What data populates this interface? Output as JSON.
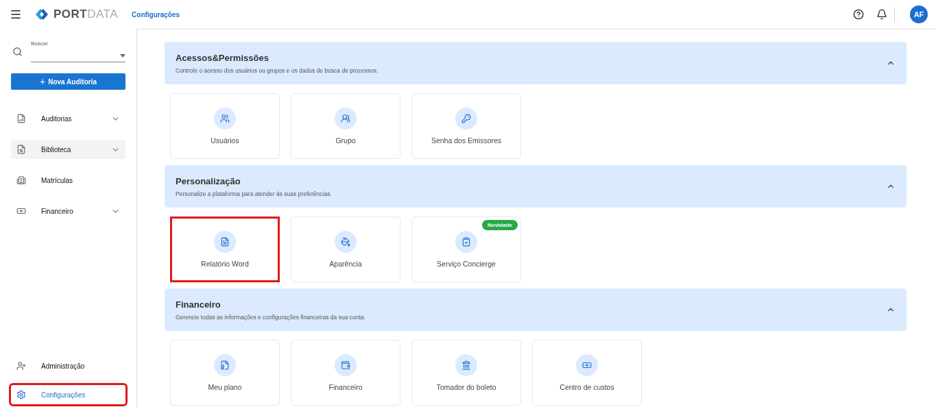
{
  "header": {
    "logo": {
      "bold": "PORT",
      "light": "DATA"
    },
    "breadcrumb": "Configurações",
    "avatar": "AF"
  },
  "sidebar": {
    "search": {
      "label": "Buscar"
    },
    "new_button": {
      "icon": "+",
      "label": "Nova Auditoria"
    },
    "items": [
      {
        "kind": "audits",
        "label": "Auditorias",
        "expandable": true,
        "hovered": false,
        "selected": false
      },
      {
        "kind": "library",
        "label": "Biblioteca",
        "expandable": true,
        "hovered": true,
        "selected": false
      },
      {
        "kind": "enrollments",
        "label": "Matrículas",
        "expandable": false,
        "hovered": false,
        "selected": false
      },
      {
        "kind": "finance",
        "label": "Financeiro",
        "expandable": true,
        "hovered": false,
        "selected": false
      }
    ],
    "bottom_items": [
      {
        "kind": "admin",
        "label": "Administração",
        "selected": false,
        "highlighted": false
      },
      {
        "kind": "settings",
        "label": "Configurações",
        "selected": true,
        "highlighted": true
      }
    ]
  },
  "sections": [
    {
      "title": "Acessos&Permissões",
      "subtitle": "Controle o acesso dos usuários ou grupos e os dados de busca de processos.",
      "expanded": true,
      "cards": [
        {
          "kind": "users",
          "label": "Usuários",
          "highlighted": false
        },
        {
          "kind": "group",
          "label": "Grupo",
          "highlighted": false
        },
        {
          "kind": "key",
          "label": "Senha dos Emissores",
          "highlighted": false
        }
      ]
    },
    {
      "title": "Personalização",
      "subtitle": "Personalize a plataforma para atender às suas preferências.",
      "expanded": true,
      "cards": [
        {
          "kind": "word",
          "label": "Relatório Word",
          "highlighted": true
        },
        {
          "kind": "paint",
          "label": "Aparência",
          "highlighted": false
        },
        {
          "kind": "concierge",
          "label": "Serviço Concierge",
          "highlighted": false,
          "badge": "Novidade"
        }
      ]
    },
    {
      "title": "Financeiro",
      "subtitle": "Gerencie todas as informações e configurações financeiras da sua conta.",
      "expanded": true,
      "cards": [
        {
          "kind": "plan",
          "label": "Meu plano",
          "highlighted": false
        },
        {
          "kind": "wallet",
          "label": "Financeiro",
          "highlighted": false
        },
        {
          "kind": "bank",
          "label": "Tomador do boleto",
          "highlighted": false
        },
        {
          "kind": "money",
          "label": "Centro de custos",
          "highlighted": false
        }
      ]
    }
  ]
}
